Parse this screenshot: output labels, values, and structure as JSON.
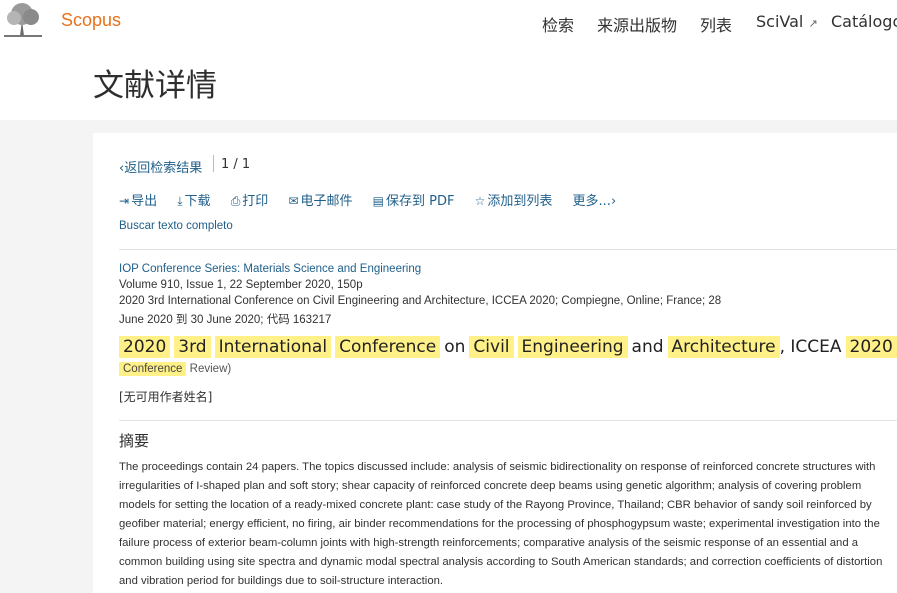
{
  "header": {
    "brand": "Scopus",
    "nav": {
      "search": "检索",
      "sources": "来源出版物",
      "lists": "列表",
      "scival": "SciVal",
      "scival_icon": "external-link-arrow",
      "catalog": "Catálogo e"
    },
    "page_title": "文献详情"
  },
  "breadcrumb": {
    "back": "返回检索结果",
    "back_icon": "chevron-left",
    "pager": "1 / 1"
  },
  "toolbar": {
    "export": "导出",
    "download": "下载",
    "print": "打印",
    "email": "电子邮件",
    "save_pdf": "保存到 PDF",
    "add_to_list": "添加到列表",
    "more": "更多..."
  },
  "full_text_link": "Buscar texto completo",
  "source": {
    "journal": "IOP Conference Series: Materials Science and Engineering",
    "volume": "Volume 910, Issue 1, 22 September 2020, 150p",
    "conference_line1": "2020 3rd International Conference on Civil Engineering and Architecture, ICCEA 2020; Compiegne, Online; France; 28",
    "conference_line2": "June 2020 到 30 June 2020; 代码 163217"
  },
  "title_words": {
    "w1": "2020",
    "w2": "3rd",
    "w3": "International",
    "w4": "Conference",
    "w5": "on",
    "w6": "Civil",
    "w7": "Engineering",
    "w8": "and",
    "w9": "Architecture",
    "w10": ", ICCEA",
    "w11": "2020",
    "w12": "("
  },
  "doc_type": {
    "type": "Conference",
    "rest": "Review)"
  },
  "authors": "[无可用作者姓名]",
  "abstract": {
    "heading": "摘要",
    "text": "The proceedings contain 24 papers. The topics discussed include: analysis of seismic bidirectionality on response of reinforced concrete structures with irregularities of I-shaped plan and soft story; shear capacity of reinforced concrete deep beams using genetic algorithm; analysis of covering problem models for setting the location of a ready-mixed concrete plant: case study of the Rayong Province, Thailand; CBR behavior of sandy soil reinforced by geofiber material; energy efficient, no firing, air binder recommendations for the processing of phosphogypsum waste; experimental investigation into the failure process of exterior beam-column joints with high-strength reinforcements; comparative analysis of the seismic response of an essential and a common building using site spectra and dynamic modal spectral analysis according to South American standards; and correction coefficients of distortion and vibration period for buildings due to soil-structure interaction."
  },
  "colors": {
    "brand": "#e9711c",
    "link": "#1f5f8a",
    "highlight": "#fff187",
    "page_bg": "#f4f4f4"
  }
}
